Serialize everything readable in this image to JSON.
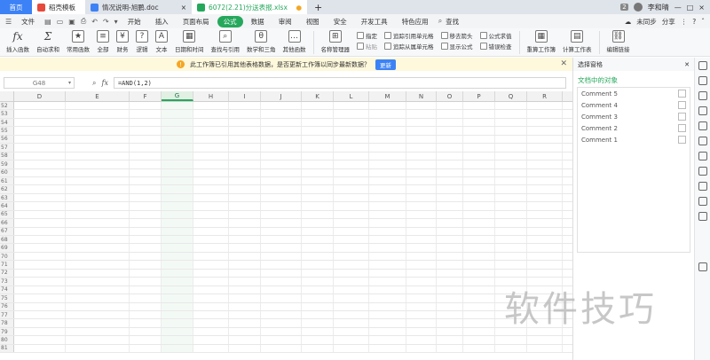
{
  "tabs": {
    "home": "首页",
    "templates": "稻壳模板",
    "word_doc": "情况说明-旭鹏.doc",
    "xls_doc": "6072(2.21)分送表报.xlsx",
    "new_tab": "+",
    "notifications": "2",
    "user": "李和晴"
  },
  "menubar": {
    "file": "文件",
    "items": [
      "开始",
      "插入",
      "页面布局",
      "公式",
      "数据",
      "审阅",
      "视图",
      "安全",
      "开发工具",
      "特色应用"
    ],
    "active": "公式",
    "search": "查找",
    "sync": "未同步",
    "share": "分享"
  },
  "ribbon": {
    "insert_function": "插入函数",
    "autosum": "自动求和",
    "common": "常用函数",
    "all": "全部",
    "finance": "财务",
    "logic": "逻辑",
    "text": "文本",
    "datetime": "日期和时间",
    "lookup": "查找与引用",
    "math": "数学和三角",
    "other": "其他函数",
    "name_manager": "名称管理器",
    "define": "指定",
    "paste": "粘贴",
    "trace_precedents": "追踪引用单元格",
    "trace_dependents": "追踪从属单元格",
    "remove_arrows": "移去箭头",
    "show_formulas": "显示公式",
    "formula_eval": "公式求值",
    "error_check": "错误检查",
    "recalc_book": "重算工作簿",
    "calc_sheet": "计算工作表",
    "edit_links": "编辑链接"
  },
  "notice": {
    "text": "此工作簿已引用其他表格数据，是否更新工作簿以同步最新数据？",
    "button": "更新"
  },
  "formula": {
    "namebox": "G48",
    "fx": "fx",
    "value": "=AND(1,2)"
  },
  "grid": {
    "columns": [
      "D",
      "E",
      "F",
      "G",
      "H",
      "I",
      "J",
      "K",
      "L",
      "M",
      "N",
      "O",
      "P",
      "Q",
      "R"
    ],
    "selected_column": "G",
    "rows": [
      "52",
      "53",
      "54",
      "55",
      "56",
      "57",
      "58",
      "59",
      "60",
      "61",
      "62",
      "63",
      "64",
      "65",
      "66",
      "67",
      "68",
      "69",
      "70",
      "71",
      "72",
      "73",
      "74",
      "75",
      "76",
      "77",
      "78",
      "79",
      "80",
      "81"
    ]
  },
  "pane": {
    "title": "选择窗格",
    "subtitle": "文档中的对象",
    "objects": [
      "Comment 5",
      "Comment 4",
      "Comment 3",
      "Comment 2",
      "Comment 1"
    ]
  },
  "watermark": "软件技巧"
}
